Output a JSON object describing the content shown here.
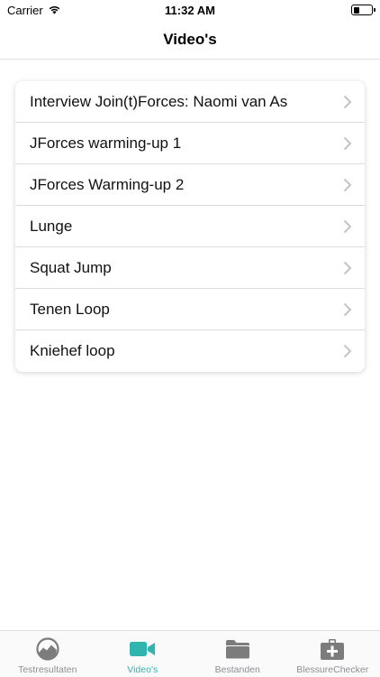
{
  "status_bar": {
    "carrier": "Carrier",
    "time": "11:32 AM"
  },
  "nav": {
    "title": "Video's"
  },
  "videos": [
    {
      "label": "Interview Join(t)Forces: Naomi van As"
    },
    {
      "label": "JForces warming-up 1"
    },
    {
      "label": "JForces Warming-up 2"
    },
    {
      "label": "Lunge"
    },
    {
      "label": "Squat Jump"
    },
    {
      "label": "Tenen Loop"
    },
    {
      "label": "Kniehef loop"
    }
  ],
  "tabs": [
    {
      "label": "Testresultaten",
      "icon": "chart-circle-icon",
      "active": false
    },
    {
      "label": "Video's",
      "icon": "video-camera-icon",
      "active": true
    },
    {
      "label": "Bestanden",
      "icon": "folder-icon",
      "active": false
    },
    {
      "label": "BlessureChecker",
      "icon": "first-aid-kit-icon",
      "active": false
    }
  ],
  "colors": {
    "accent": "#2fb4ae",
    "inactive": "#8e8e93",
    "icon_gray": "#7c7c7c"
  }
}
